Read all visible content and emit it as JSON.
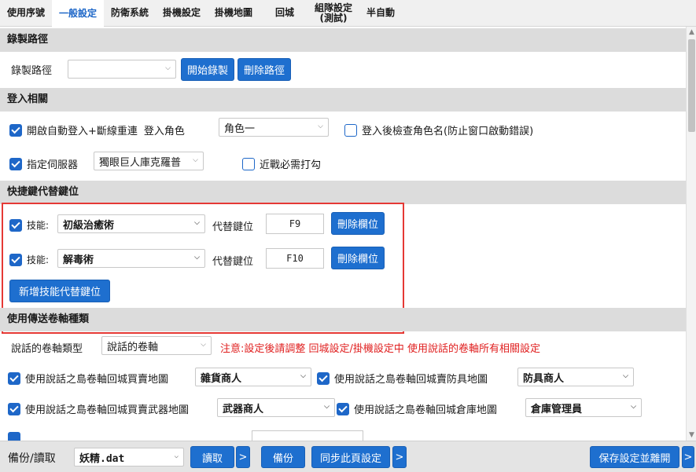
{
  "tabs": [
    {
      "label": "使用序號"
    },
    {
      "label": "一般設定"
    },
    {
      "label": "防衛系統"
    },
    {
      "label": "掛機設定"
    },
    {
      "label": "掛機地圖"
    },
    {
      "label": "回城"
    },
    {
      "label": "組隊設定\n(測試)"
    },
    {
      "label": "半自動"
    }
  ],
  "sections": {
    "record_path": "錄製路徑",
    "login": "登入相關",
    "hotkey": "快捷鍵代替鍵位",
    "scroll": "使用傳送卷軸種類"
  },
  "record": {
    "label": "錄製路徑",
    "select_value": "",
    "start_btn": "開始錄製",
    "delete_btn": "刪除路徑"
  },
  "login": {
    "auto_login_label": "開啟自動登入+斷線重連",
    "role_label": "登入角色",
    "role_value": "角色一",
    "check_name_label": "登入後檢查角色名(防止窗口啟動錯誤)",
    "server_label": "指定伺服器",
    "server_value": "獨眼巨人庫克羅普",
    "melee_label": "近戰必需打勾"
  },
  "hotkey": {
    "rows": [
      {
        "skill_label": "技能:",
        "skill_value": "初級治癒術",
        "replace_label": "代替鍵位",
        "key": "F9",
        "delete_btn": "刪除欄位"
      },
      {
        "skill_label": "技能:",
        "skill_value": "解毒術",
        "replace_label": "代替鍵位",
        "key": "F10",
        "delete_btn": "刪除欄位"
      }
    ],
    "add_btn": "新增技能代替鍵位"
  },
  "scroll": {
    "type_label": "說話的卷軸類型",
    "type_value": "說話的卷軸",
    "warning": "注意:設定後請調整 回城設定/掛機設定中 使用說話的卷軸所有相關設定",
    "buy_sell_label": "使用說話之島卷軸回城買賣地圖",
    "buy_sell_value": "雜貨商人",
    "armor_label": "使用說話之島卷軸回城賣防具地圖",
    "armor_value": "防具商人",
    "weapon_label": "使用說話之島卷軸回城買賣武器地圖",
    "weapon_value": "武器商人",
    "warehouse_label": "使用說話之島卷軸回城倉庫地圖",
    "warehouse_value": "倉庫管理員"
  },
  "bottom": {
    "label": "備份/讀取",
    "file_value": "妖精.dat",
    "read_btn": "讀取",
    "more": ">",
    "backup_btn": "備份",
    "sync_btn": "同步此頁設定",
    "save_exit_btn": "保存設定並離開"
  },
  "colors": {
    "accent": "#1e6fcf",
    "active_tab_text": "#1e67c8",
    "section_bg": "#dcdcdc",
    "warning": "#e02020",
    "highlight_box": "#e53935"
  }
}
